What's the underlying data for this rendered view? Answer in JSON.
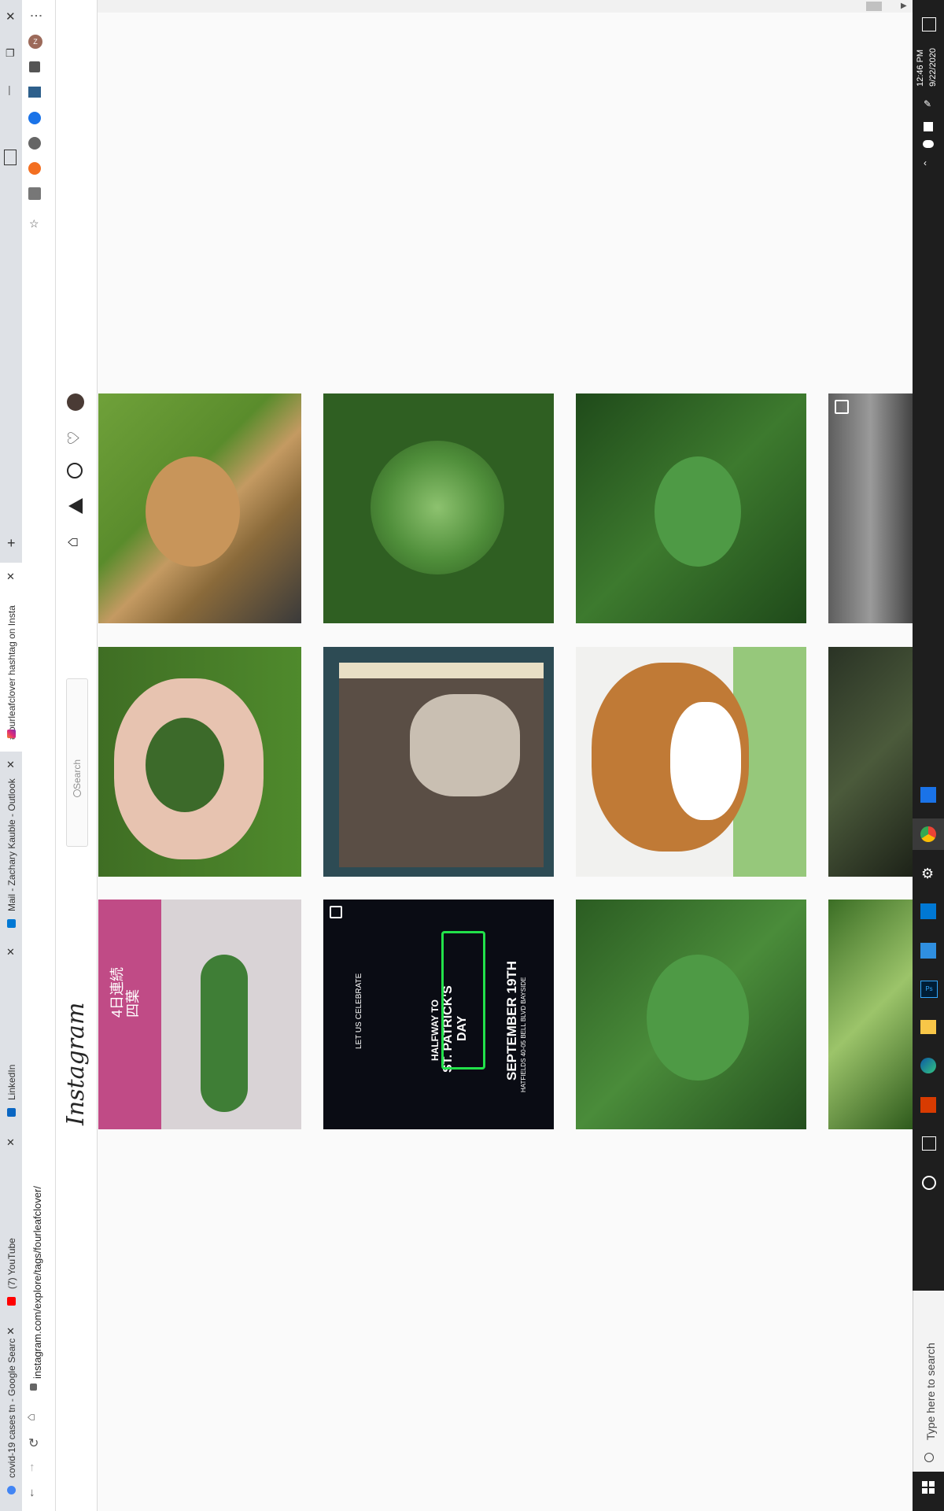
{
  "browser": {
    "tabs": [
      {
        "label": "covid-19 cases tn - Google Searc",
        "close": "✕",
        "favicon_color": "#4285f4"
      },
      {
        "label": "(7) YouTube",
        "close": "✕",
        "favicon_color": "#ff0000"
      },
      {
        "label": "LinkedIn",
        "close": "✕",
        "favicon_color": "#0a66c2"
      },
      {
        "label": "Mail - Zachary Kauble - Outlook",
        "close": "✕",
        "favicon_color": "#0078d4"
      },
      {
        "label": "#fourleafclover hashtag on Insta",
        "close": "✕",
        "favicon_color": "#e1306c"
      }
    ],
    "new_tab": "+",
    "address": "instagram.com/explore/tags/fourleafclover/",
    "window_controls": {
      "close": "✕",
      "restore": "❐",
      "minimize": "—"
    },
    "menu": "⋮"
  },
  "instagram": {
    "logo": "Instagram",
    "search_placeholder": "Search"
  },
  "grid_posts": [
    {
      "alt": "dog-on-grass"
    },
    {
      "alt": "four-leaf-clover-1"
    },
    {
      "alt": "clover-in-ferns"
    },
    {
      "alt": "skin-closeup",
      "multi": true
    },
    {
      "alt": "hand-with-clovers"
    },
    {
      "alt": "rocks-on-book"
    },
    {
      "alt": "beagle-painting"
    },
    {
      "alt": "dark-plants"
    },
    {
      "alt": "clovers-on-box"
    },
    {
      "alt": "st-patricks-flyer",
      "video": true
    },
    {
      "alt": "clover-in-greens"
    },
    {
      "alt": "green-plant"
    }
  ],
  "flyer": {
    "line1": "LET US CELEBRATE",
    "line2": "HALFWAY TO",
    "line3": "ST. PATRICK'S",
    "line4": "DAY",
    "line5": "SEPTEMBER 19TH",
    "line6": "HATFIELDS 40-05 BELL BLVD BAYSIDE"
  },
  "box_text": {
    "line1": "4日連続",
    "line2": "四葉"
  },
  "taskbar": {
    "time": "12:46 PM",
    "date": "9/22/2020",
    "search_placeholder": "Type here to search"
  },
  "colors": {
    "instagram_grad": "#e1306c",
    "chrome_tab": "#dee1e6",
    "taskbar": "#1e1e1e"
  }
}
